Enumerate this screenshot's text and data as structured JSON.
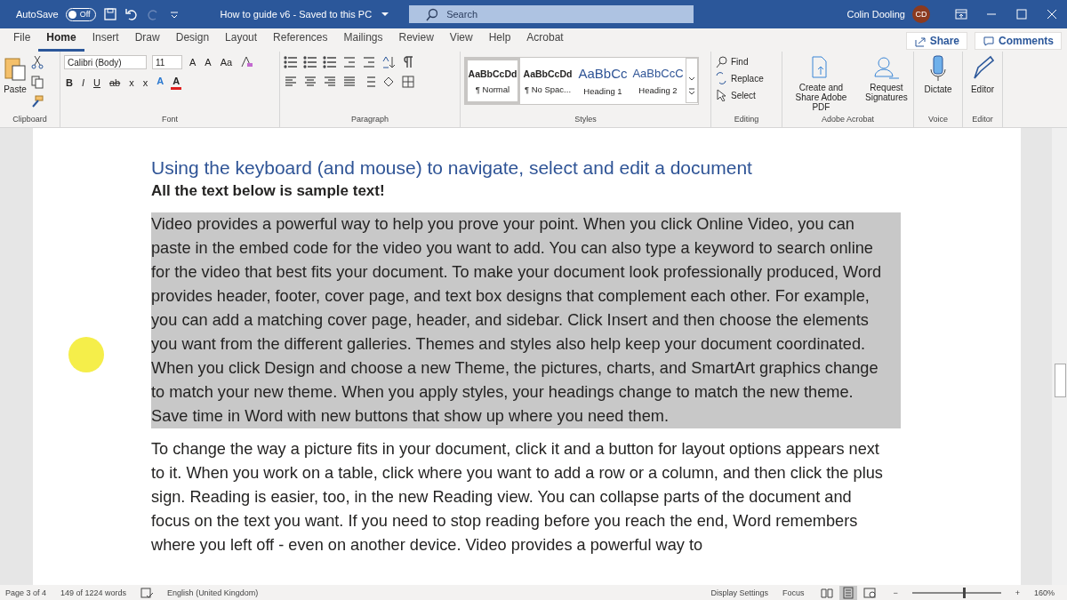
{
  "title_bar": {
    "autosave_label": "AutoSave",
    "autosave_toggle": {
      "label": "Off",
      "on": false
    },
    "document_title": "How to guide v6  -  Saved to this PC",
    "search": {
      "placeholder": "Search"
    },
    "user_name": "Colin Dooling",
    "avatar_initials": "CD"
  },
  "tabs": [
    {
      "label": "File",
      "selected": false
    },
    {
      "label": "Home",
      "selected": true
    },
    {
      "label": "Insert",
      "selected": false
    },
    {
      "label": "Draw",
      "selected": false
    },
    {
      "label": "Design",
      "selected": false
    },
    {
      "label": "Layout",
      "selected": false
    },
    {
      "label": "References",
      "selected": false
    },
    {
      "label": "Mailings",
      "selected": false
    },
    {
      "label": "Review",
      "selected": false
    },
    {
      "label": "View",
      "selected": false
    },
    {
      "label": "Help",
      "selected": false
    },
    {
      "label": "Acrobat",
      "selected": false
    }
  ],
  "share_button": "Share",
  "comments_button": "Comments",
  "ribbon": {
    "clipboard": {
      "paste": "Paste",
      "label": "Clipboard"
    },
    "font": {
      "font_name": "Calibri (Body)",
      "font_size": "11",
      "size_buttons": [
        "A",
        "A",
        "Aa"
      ],
      "format_buttons": [
        "B",
        "I",
        "U",
        "ab",
        "x",
        "x"
      ],
      "color_buttons": [
        "A",
        "A"
      ],
      "label": "Font"
    },
    "paragraph": {
      "label": "Paragraph"
    },
    "styles": {
      "items": [
        {
          "preview": "AaBbCcDd",
          "name": "¶ Normal",
          "kind": "body",
          "selected": true
        },
        {
          "preview": "AaBbCcDd",
          "name": "¶ No Spac...",
          "kind": "body",
          "selected": false
        },
        {
          "preview": "AaBbCc",
          "name": "Heading 1",
          "kind": "heading1",
          "selected": false
        },
        {
          "preview": "AaBbCcC",
          "name": "Heading 2",
          "kind": "heading2",
          "selected": false
        }
      ],
      "label": "Styles"
    },
    "editing": {
      "buttons": [
        "Find",
        "Replace",
        "Select"
      ],
      "label": "Editing"
    },
    "acrobat": {
      "buttons": [
        "Create and Share Adobe PDF",
        "Request Signatures"
      ],
      "label": "Adobe Acrobat"
    },
    "voice": {
      "button": "Dictate",
      "label": "Voice"
    },
    "editor": {
      "button": "Editor",
      "label": "Editor"
    }
  },
  "document": {
    "heading": "Using the keyboard (and mouse) to navigate, select and edit a document",
    "subheading": "All the text below is sample text!",
    "paragraphs": [
      {
        "text": "Video provides a powerful way to help you prove your point. When you click Online Video, you can paste in the embed code for the video you want to add. You can also type a keyword to search online for the video that best fits your document. To make your document look professionally produced, Word provides header, footer, cover page, and text box designs that complement each other. For example, you can add a matching cover page, header, and sidebar. Click Insert and then choose the elements you want from the different galleries. Themes and styles also help keep your document coordinated. When you click Design and choose a new Theme, the pictures, charts, and SmartArt graphics change to match your new theme. When you apply styles, your headings change to match the new theme. Save time in Word with new buttons that show up where you need them.",
        "selected": true
      },
      {
        "text": "To change the way a picture fits in your document, click it and a button for layout options appears next to it. When you work on a table, click where you want to add a row or a column, and then click the plus sign. Reading is easier, too, in the new Reading view. You can collapse parts of the document and focus on the text you want. If you need to stop reading before you reach the end, Word remembers where you left off - even on another device. Video provides a powerful way to",
        "selected": false
      }
    ]
  },
  "status_bar": {
    "page": "Page 3 of 4",
    "words": "149 of 1224 words",
    "language": "English (United Kingdom)",
    "display_settings": "Display Settings",
    "focus": "Focus",
    "views": [
      {
        "kind": "read",
        "selected": false
      },
      {
        "kind": "print",
        "selected": true
      },
      {
        "kind": "web",
        "selected": false
      }
    ],
    "zoom": {
      "minus": "−",
      "plus": "+",
      "level": 0.57,
      "reading": "160%"
    }
  }
}
